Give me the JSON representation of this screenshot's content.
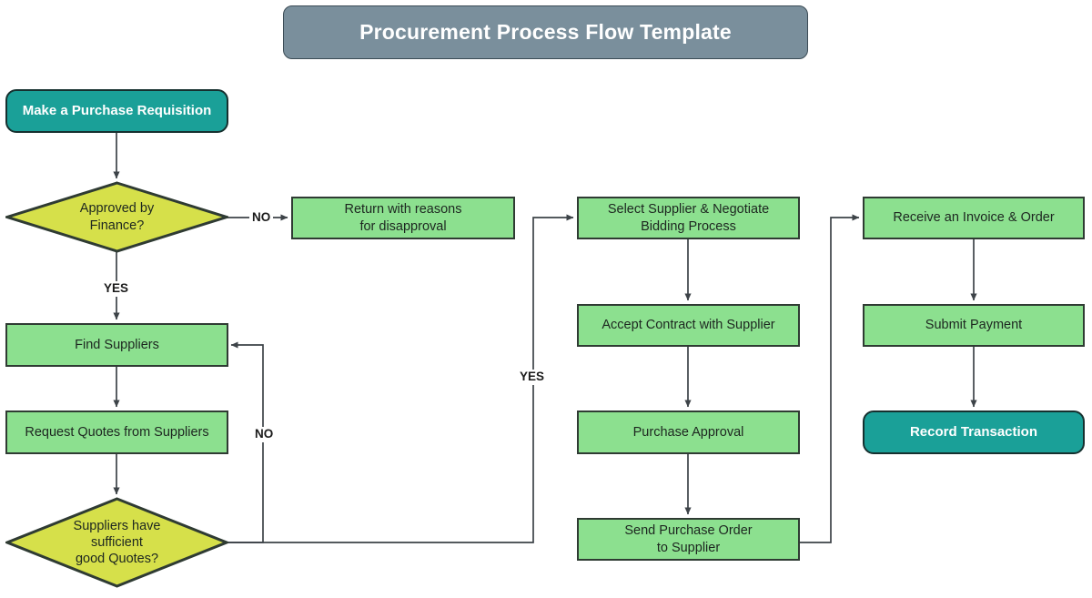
{
  "diagram": {
    "title": "Procurement Process Flow Template",
    "type": "flowchart",
    "colors": {
      "title_bar": "#7a8f9c",
      "terminator": "#1aa098",
      "process": "#8ce08f",
      "decision": "#d6e04a",
      "stroke": "#2f3b33",
      "connector": "#3d4348",
      "text_dark": "#1d2620",
      "text_light": "#ffffff",
      "background": "#ffffff"
    },
    "nodes": {
      "title_bar": "Procurement Process Flow Template",
      "start": "Make a Purchase Requisition",
      "decision_finance": "Approved by\nFinance?",
      "return_reasons": "Return with reasons\nfor disapproval",
      "find_suppliers": "Find Suppliers",
      "request_quotes": "Request Quotes from Suppliers",
      "decision_quotes": "Suppliers have\nsufficient\ngood Quotes?",
      "select_supplier": "Select Supplier & Negotiate\nBidding Process",
      "accept_contract": "Accept Contract with Supplier",
      "purchase_approval": "Purchase Approval",
      "send_purchase_order": "Send Purchase Order\nto Supplier",
      "receive_invoice": "Receive an Invoice & Order",
      "submit_payment": "Submit Payment",
      "record_transaction": "Record Transaction"
    },
    "edge_labels": {
      "finance_no": "NO",
      "finance_yes": "YES",
      "quotes_no": "NO",
      "quotes_yes": "YES"
    }
  }
}
